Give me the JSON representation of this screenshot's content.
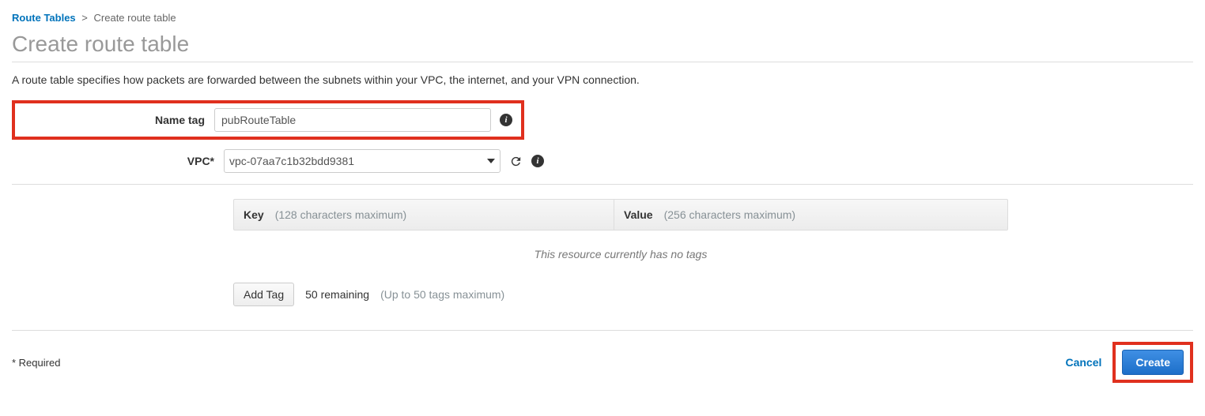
{
  "breadcrumb": {
    "parent": "Route Tables",
    "separator": ">",
    "current": "Create route table"
  },
  "page_title": "Create route table",
  "description": "A route table specifies how packets are forwarded between the subnets within your VPC, the internet, and your VPN connection.",
  "form": {
    "name_tag_label": "Name tag",
    "name_tag_value": "pubRouteTable",
    "vpc_label": "VPC*",
    "vpc_value": "vpc-07aa7c1b32bdd9381"
  },
  "tags": {
    "key_header": "Key",
    "key_hint": "(128 characters maximum)",
    "value_header": "Value",
    "value_hint": "(256 characters maximum)",
    "no_tags_text": "This resource currently has no tags",
    "add_tag_button": "Add Tag",
    "remaining_text": "50 remaining",
    "max_hint": "(Up to 50 tags maximum)"
  },
  "footer": {
    "required_note": "* Required",
    "cancel": "Cancel",
    "create": "Create"
  }
}
